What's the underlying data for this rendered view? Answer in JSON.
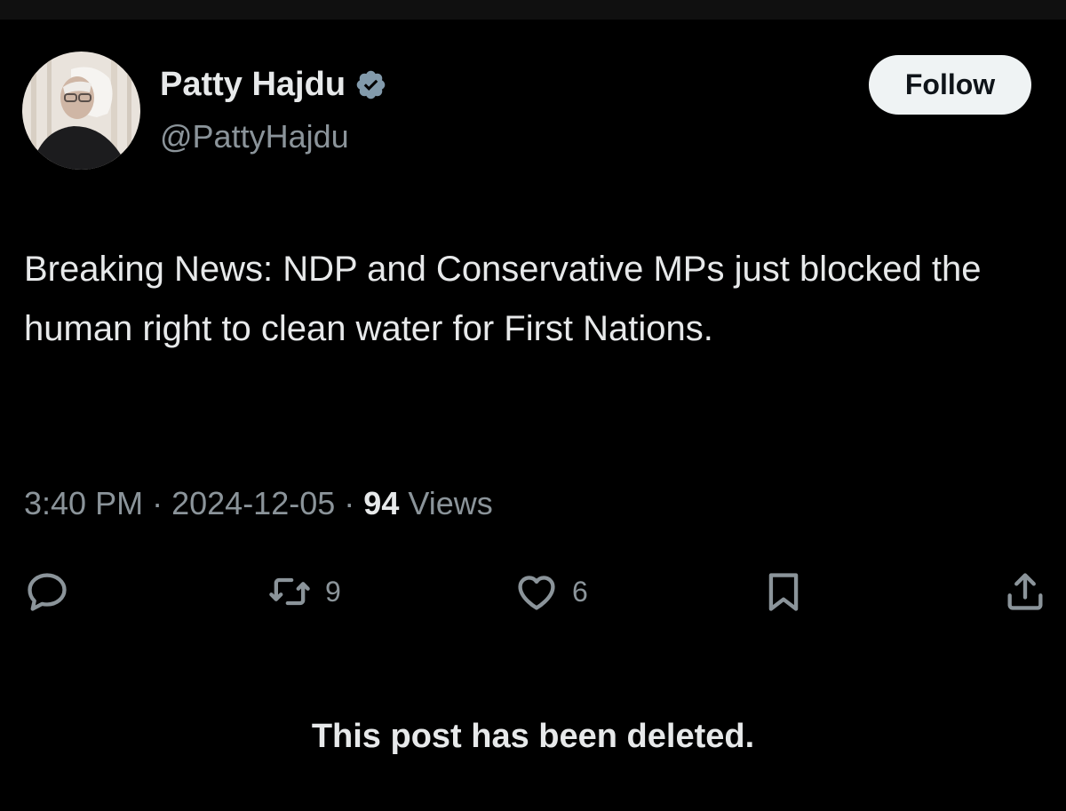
{
  "author": {
    "display_name": "Patty Hajdu",
    "handle": "@PattyHajdu",
    "verified": true
  },
  "follow_label": "Follow",
  "post": {
    "text": "Breaking News: NDP and Conservative MPs just blocked the human right to clean water for First Nations.",
    "time": "3:40 PM",
    "separator": "·",
    "date": "2024-12-05",
    "views_count": "94",
    "views_label": "Views"
  },
  "actions": {
    "reply_count": "",
    "repost_count": "9",
    "like_count": "6"
  },
  "notice": "This post has been deleted.",
  "colors": {
    "background": "#000000",
    "primary_text": "#e7e9ea",
    "secondary_text": "#8b949a",
    "follow_button_bg": "#eff3f4",
    "verified_badge": "#829aab"
  },
  "icons": [
    "verified-icon",
    "reply-icon",
    "repost-icon",
    "like-icon",
    "bookmark-icon",
    "share-icon"
  ]
}
